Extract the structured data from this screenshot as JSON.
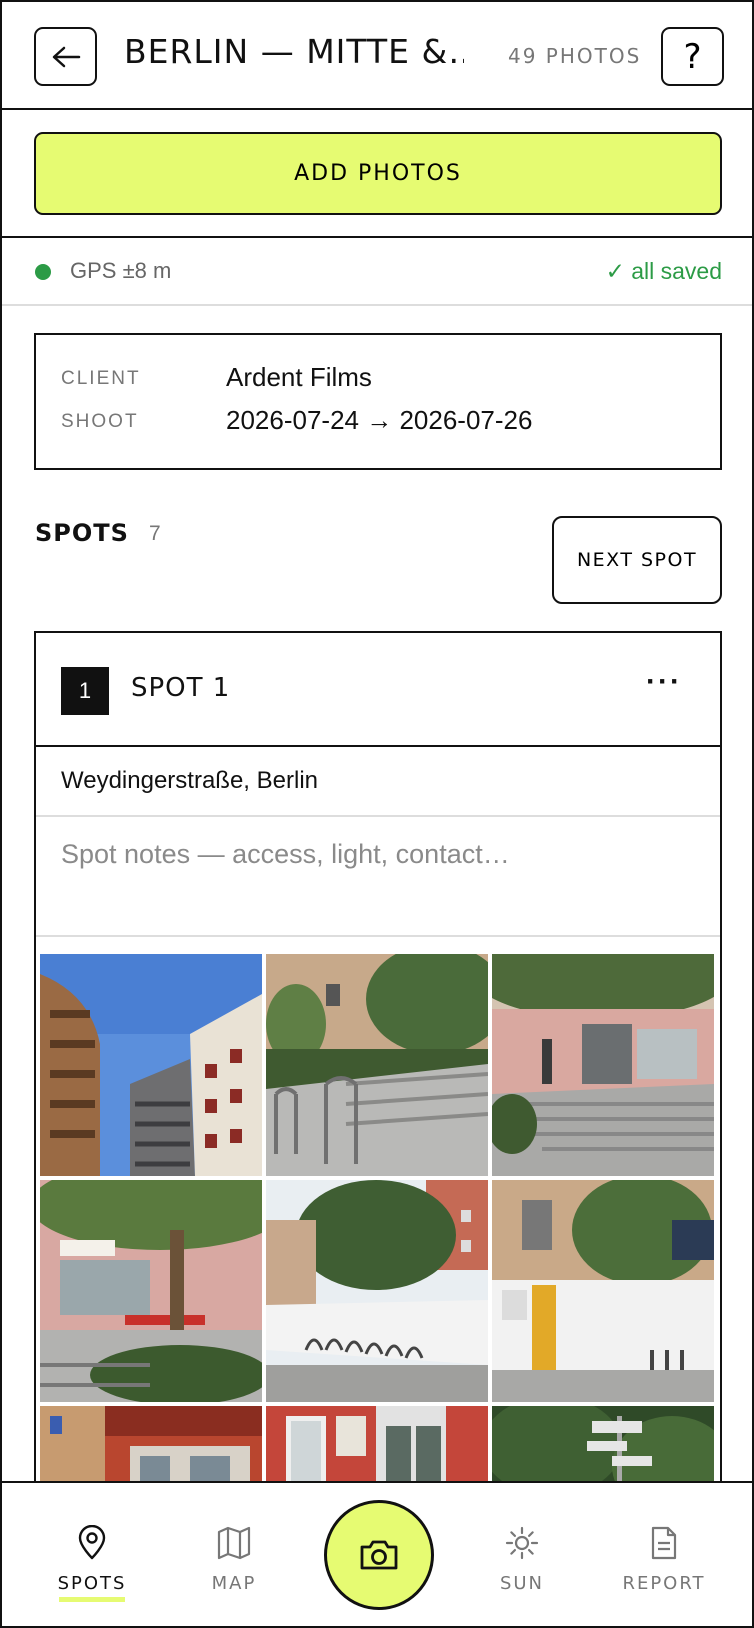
{
  "header": {
    "title": "BERLIN — MITTE &…",
    "photo_count": "49 PHOTOS",
    "help_label": "?"
  },
  "actions": {
    "add_photos": "ADD PHOTOS"
  },
  "status": {
    "gps": "GPS ±8 m",
    "saved": "✓ all saved",
    "gps_color": "#2c9b46"
  },
  "project": {
    "client_label": "CLIENT",
    "client_value": "Ardent Films",
    "shoot_label": "SHOOT",
    "shoot_value": "2026-07-24 → 2026-07-26"
  },
  "spots": {
    "label": "SPOTS",
    "count": "7",
    "next_label": "NEXT SPOT"
  },
  "spot": {
    "number": "1",
    "name": "SPOT 1",
    "more": "···",
    "address": "Weydingerstraße, Berlin",
    "notes_placeholder": "Spot notes — access, light, contact…",
    "photos": [
      {
        "icon": "photo-building-sky"
      },
      {
        "icon": "photo-ramp-railings"
      },
      {
        "icon": "photo-entrance-steps"
      },
      {
        "icon": "photo-shopfront-tree"
      },
      {
        "icon": "photo-bike-racks-wall"
      },
      {
        "icon": "photo-yellow-door"
      },
      {
        "icon": "photo-red-building"
      },
      {
        "icon": "photo-red-doorway"
      },
      {
        "icon": "photo-street-signs"
      }
    ]
  },
  "tabs": [
    {
      "label": "SPOTS",
      "icon": "map-pin-icon",
      "active": true
    },
    {
      "label": "MAP",
      "icon": "map-icon",
      "active": false
    },
    {
      "label": "SUN",
      "icon": "sun-icon",
      "active": false
    },
    {
      "label": "REPORT",
      "icon": "document-icon",
      "active": false
    }
  ],
  "colors": {
    "accent": "#e6fb72",
    "ink": "#111111",
    "muted": "#777777",
    "success": "#2c9b46"
  }
}
